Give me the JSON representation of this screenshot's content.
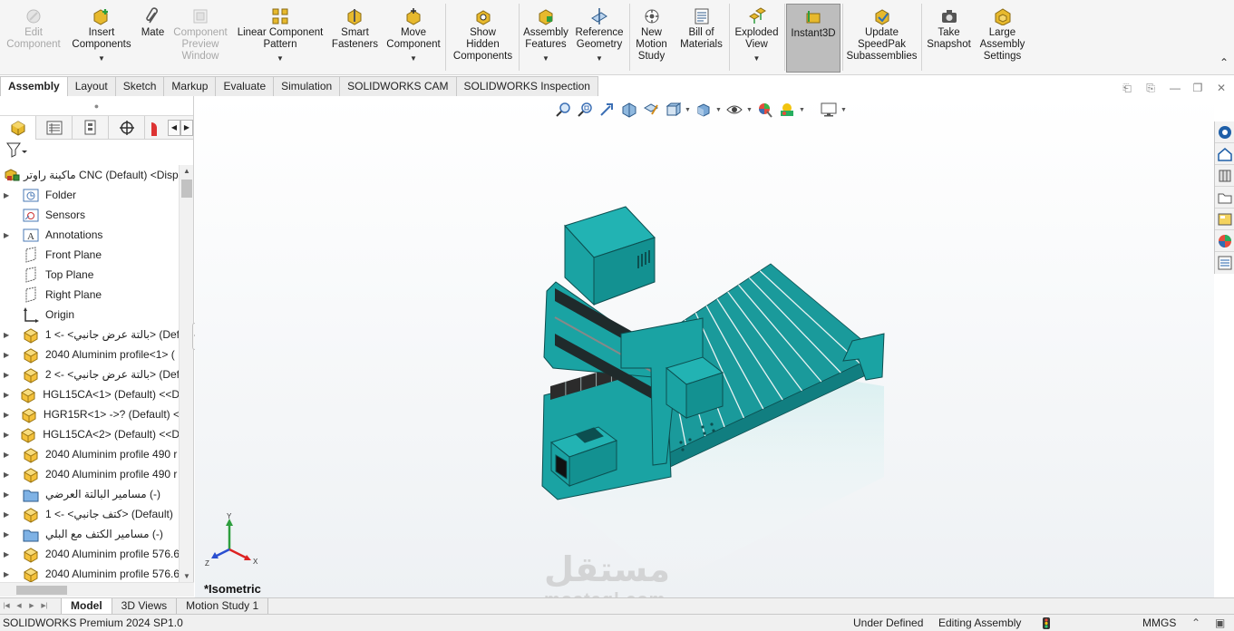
{
  "ribbon": {
    "buttons": [
      {
        "name": "edit-component-button",
        "label": "Edit\nComponent",
        "icon": "edit-component-icon",
        "disabled": true,
        "caret": false
      },
      {
        "name": "insert-components-button",
        "label": "Insert\nComponents",
        "icon": "insert-components-icon",
        "disabled": false,
        "caret": true
      },
      {
        "name": "mate-button",
        "label": "Mate",
        "icon": "paperclip-mate-icon",
        "disabled": false,
        "caret": false
      },
      {
        "name": "component-preview-window-button",
        "label": "Component\nPreview\nWindow",
        "icon": "preview-window-icon",
        "disabled": true,
        "caret": false
      },
      {
        "name": "linear-component-pattern-button",
        "label": "Linear Component\nPattern",
        "icon": "linear-pattern-icon",
        "disabled": false,
        "caret": true
      },
      {
        "name": "smart-fasteners-button",
        "label": "Smart\nFasteners",
        "icon": "smart-fasteners-icon",
        "disabled": false,
        "caret": false
      },
      {
        "name": "move-component-button",
        "label": "Move\nComponent",
        "icon": "move-component-icon",
        "disabled": false,
        "caret": true
      },
      {
        "name": "show-hidden-components-button",
        "label": "Show\nHidden\nComponents",
        "icon": "show-hidden-icon",
        "disabled": false,
        "caret": false
      },
      {
        "name": "assembly-features-button",
        "label": "Assembly\nFeatures",
        "icon": "assembly-features-icon",
        "disabled": false,
        "caret": true
      },
      {
        "name": "reference-geometry-button",
        "label": "Reference\nGeometry",
        "icon": "reference-geometry-icon",
        "disabled": false,
        "caret": true
      },
      {
        "name": "new-motion-study-button",
        "label": "New\nMotion\nStudy",
        "icon": "motion-study-icon",
        "disabled": false,
        "caret": false
      },
      {
        "name": "bill-of-materials-button",
        "label": "Bill of\nMaterials",
        "icon": "bill-of-materials-icon",
        "disabled": false,
        "caret": false
      },
      {
        "name": "exploded-view-button",
        "label": "Exploded\nView",
        "icon": "exploded-view-icon",
        "disabled": false,
        "caret": true
      },
      {
        "name": "instant3d-button",
        "label": "Instant3D",
        "icon": "instant3d-icon",
        "disabled": false,
        "caret": false
      },
      {
        "name": "update-speedpak-button",
        "label": "Update\nSpeedPak\nSubassemblies",
        "icon": "speedpak-icon",
        "disabled": false,
        "caret": false
      },
      {
        "name": "take-snapshot-button",
        "label": "Take\nSnapshot",
        "icon": "camera-icon",
        "disabled": false,
        "caret": false
      },
      {
        "name": "large-assembly-settings-button",
        "label": "Large\nAssembly\nSettings",
        "icon": "large-assembly-icon",
        "disabled": false,
        "caret": false
      }
    ]
  },
  "command_tabs": [
    "Assembly",
    "Layout",
    "Sketch",
    "Markup",
    "Evaluate",
    "Simulation",
    "SOLIDWORKS CAM",
    "SOLIDWORKS Inspection"
  ],
  "tree": {
    "root": "ماكينة راوتر CNC (Default) <Displ",
    "items": [
      {
        "label": "Folder",
        "icon": "history-folder-icon",
        "expand": true
      },
      {
        "label": "Sensors",
        "icon": "sensors-icon",
        "expand": false
      },
      {
        "label": "Annotations",
        "icon": "annotations-icon",
        "expand": true
      },
      {
        "label": "Front Plane",
        "icon": "plane-icon",
        "expand": false
      },
      {
        "label": "Top Plane",
        "icon": "plane-icon",
        "expand": false
      },
      {
        "label": "Right Plane",
        "icon": "plane-icon",
        "expand": false
      },
      {
        "label": "Origin",
        "icon": "origin-icon",
        "expand": false
      },
      {
        "label": "بالتة عرض جانبي> -> 1> (Def",
        "icon": "part-icon",
        "expand": true
      },
      {
        "label": "2040 Aluminim profile<1> (",
        "icon": "part-icon",
        "expand": true
      },
      {
        "label": "بالتة عرض جانبي> -> 2> (Def",
        "icon": "part-icon",
        "expand": true
      },
      {
        "label": "HGL15CA<1> (Default) <<D",
        "icon": "part-icon",
        "expand": true
      },
      {
        "label": "HGR15R<1> ->? (Default) <",
        "icon": "part-icon",
        "expand": true
      },
      {
        "label": "HGL15CA<2> (Default) <<D",
        "icon": "part-icon",
        "expand": true
      },
      {
        "label": "2040 Aluminim profile 490 r",
        "icon": "part-icon",
        "expand": true
      },
      {
        "label": "2040 Aluminim profile 490 r",
        "icon": "part-icon",
        "expand": true
      },
      {
        "label": "مسامير البالتة العرضي (-)",
        "icon": "folder-icon",
        "expand": true
      },
      {
        "label": "كتف جانبي> -> 1> (Default)",
        "icon": "part-icon",
        "expand": true
      },
      {
        "label": "مسامير الكتف مع البلي (-)",
        "icon": "folder-icon",
        "expand": true
      },
      {
        "label": "2040 Aluminim profile 576.6",
        "icon": "part-icon",
        "expand": true
      },
      {
        "label": "2040 Aluminim profile 576.6",
        "icon": "part-icon",
        "expand": true
      }
    ]
  },
  "viewport": {
    "view_label": "*Isometric",
    "triad": {
      "x": "X",
      "y": "Y",
      "z": "Z"
    },
    "watermark": "مستقل",
    "watermark_sub": "mostaql.com"
  },
  "bottom_tabs": [
    "Model",
    "3D Views",
    "Motion Study 1"
  ],
  "status": {
    "product": "SOLIDWORKS Premium 2024 SP1.0",
    "definition": "Under Defined",
    "mode": "Editing Assembly",
    "units": "MMGS"
  },
  "colors": {
    "machine": "#1aa3a3",
    "machine_dark": "#0c6f70",
    "accent": "#3b6fb5"
  }
}
